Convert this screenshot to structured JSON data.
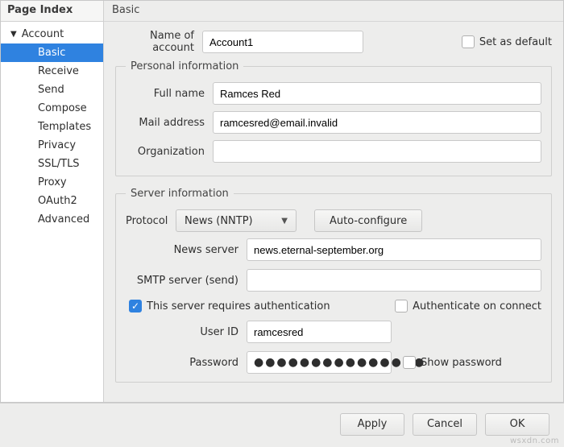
{
  "sidebar": {
    "header": "Page Index",
    "root": "Account",
    "items": [
      "Basic",
      "Receive",
      "Send",
      "Compose",
      "Templates",
      "Privacy",
      "SSL/TLS",
      "Proxy",
      "OAuth2",
      "Advanced"
    ],
    "selected_index": 0
  },
  "panel": {
    "title": "Basic",
    "account_name_label": "Name of account",
    "account_name_value": "Account1",
    "set_default_label": "Set as default",
    "set_default_checked": false
  },
  "personal": {
    "legend": "Personal information",
    "full_name_label": "Full name",
    "full_name_value": "Ramces Red",
    "mail_label": "Mail address",
    "mail_value": "ramcesred@email.invalid",
    "org_label": "Organization",
    "org_value": ""
  },
  "server": {
    "legend": "Server information",
    "protocol_label": "Protocol",
    "protocol_value": "News (NNTP)",
    "auto_configure_label": "Auto-configure",
    "news_server_label": "News server",
    "news_server_value": "news.eternal-september.org",
    "smtp_label": "SMTP server (send)",
    "smtp_value": "",
    "requires_auth_label": "This server requires authentication",
    "requires_auth_checked": true,
    "auth_on_connect_label": "Authenticate on connect",
    "auth_on_connect_checked": false,
    "user_id_label": "User ID",
    "user_id_value": "ramcesred",
    "password_label": "Password",
    "password_value": "●●●●●●●●●●●●●●●",
    "show_password_label": "Show password",
    "show_password_checked": false
  },
  "buttons": {
    "apply": "Apply",
    "cancel": "Cancel",
    "ok": "OK"
  },
  "watermark": "wsxdn.com"
}
